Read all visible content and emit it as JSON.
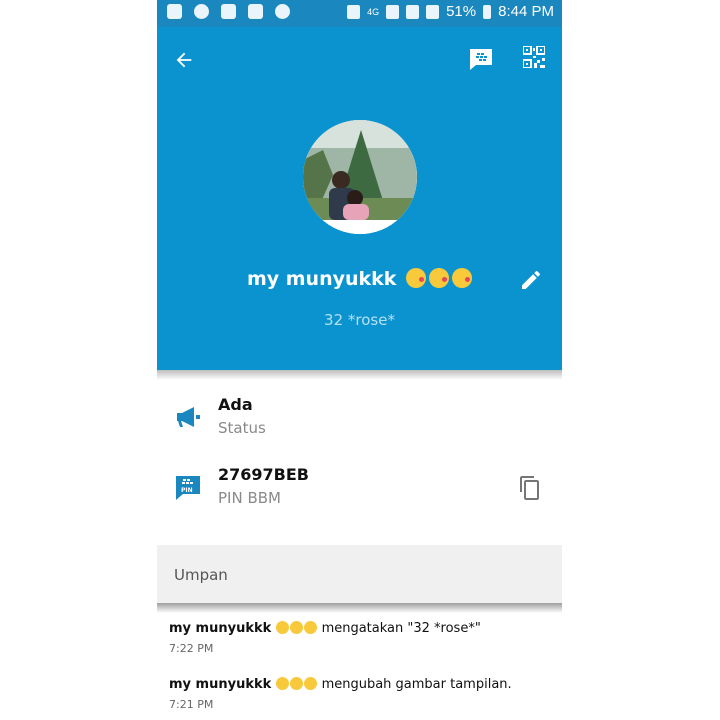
{
  "status_bar": {
    "battery": "51%",
    "time": "8:44 PM",
    "network": "4G"
  },
  "header": {
    "name": "my munyukkk",
    "name_emojis": [
      "kiss-emoji",
      "kiss-emoji",
      "kiss-emoji"
    ],
    "subtitle": "32 *rose*",
    "color": "#0a93cf"
  },
  "info": {
    "status_value": "Ada",
    "status_label": "Status",
    "pin_value": "27697BEB",
    "pin_label": "PIN BBM"
  },
  "feed": {
    "label": "Umpan",
    "items": [
      {
        "name": "my munyukkk",
        "action": "mengatakan \"32 *rose*\"",
        "time": "7:22 PM"
      },
      {
        "name": "my munyukkk",
        "action": "mengubah gambar tampilan.",
        "time": "7:21 PM"
      }
    ]
  },
  "icons": {
    "back": "back-arrow-icon",
    "chat": "bbm-chat-icon",
    "qr": "qr-code-icon",
    "edit": "pencil-icon",
    "status": "megaphone-icon",
    "pin": "bbm-pin-icon",
    "copy": "copy-icon"
  }
}
